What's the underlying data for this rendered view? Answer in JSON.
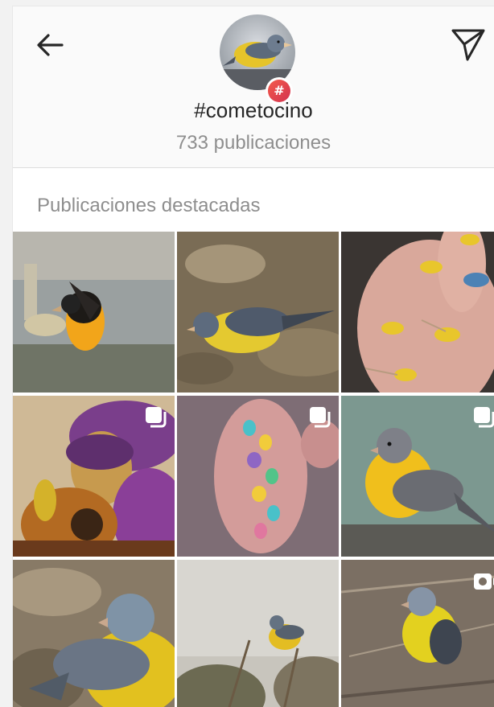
{
  "header": {
    "back_icon": "arrow-left-icon",
    "share_icon": "paper-plane-icon",
    "badge_symbol": "#",
    "hashtag": "#cometocino",
    "post_count": "733 publicaciones"
  },
  "featured": {
    "title": "Publicaciones destacadas",
    "posts": [
      {
        "kind": "bird on faucet",
        "overlay": "none"
      },
      {
        "kind": "bird on ground",
        "overlay": "none"
      },
      {
        "kind": "miniature birds on hand",
        "overlay": "none"
      },
      {
        "kind": "illustrated woman with guitar",
        "overlay": "multiple-photos-icon"
      },
      {
        "kind": "colorful crafts on hand",
        "overlay": "multiple-photos-icon"
      },
      {
        "kind": "bird on rock",
        "overlay": "multiple-photos-icon"
      },
      {
        "kind": "bird close-up",
        "overlay": "none"
      },
      {
        "kind": "bird on branch",
        "overlay": "none"
      },
      {
        "kind": "bird in grass",
        "overlay": "video-icon"
      }
    ]
  },
  "colors": {
    "background": "#ffffff",
    "header_bg": "#fafafa",
    "text_primary": "#262626",
    "text_secondary": "#8e8e8e",
    "badge_gradient_start": "#f35a4b",
    "badge_gradient_end": "#d3334f"
  }
}
